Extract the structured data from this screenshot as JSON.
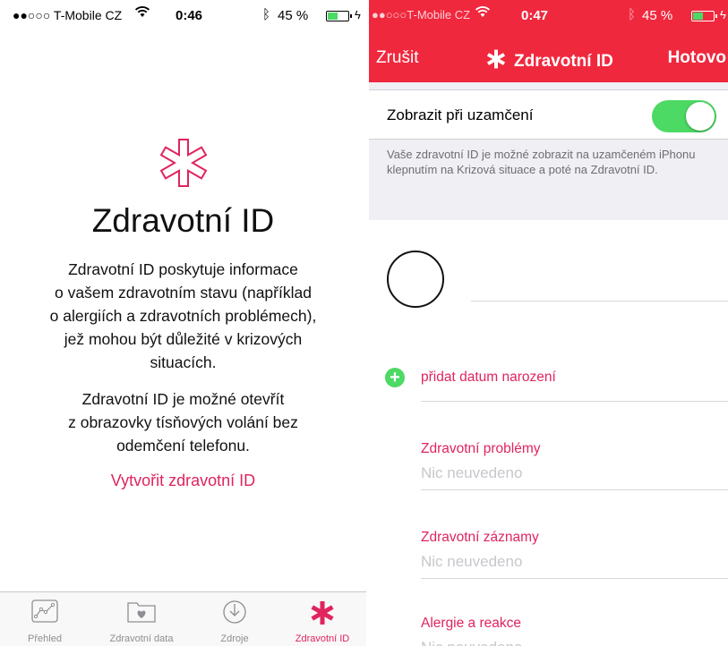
{
  "left": {
    "status_bar": {
      "carrier": "●●○○○ T-Mobile CZ",
      "time": "0:46",
      "battery_percent": "45 %"
    },
    "title": "Zdravotní ID",
    "paragraph1": [
      "Zdravotní ID poskytuje informace",
      "o vašem zdravotním stavu (například",
      "o alergiích a zdravotních problémech),",
      "jež mohou být důležité v krizových",
      "situacích."
    ],
    "paragraph2": [
      "Zdravotní ID je možné otevřít",
      "z obrazovky tísňových volání bez",
      "odemčení telefonu."
    ],
    "create_link": "Vytvořit zdravotní ID",
    "tabs": [
      {
        "label": "Přehled",
        "icon": "dashboard-chart-icon"
      },
      {
        "label": "Zdravotní data",
        "icon": "health-data-folder-icon"
      },
      {
        "label": "Zdroje",
        "icon": "sources-download-icon"
      },
      {
        "label": "Zdravotní ID",
        "icon": "medical-asterisk-icon"
      }
    ],
    "active_tab": "Zdravotní ID"
  },
  "right": {
    "status_bar": {
      "carrier": "●●○○○T-Mobile CZ",
      "time": "0:47",
      "battery_percent": "45 %"
    },
    "nav": {
      "cancel": "Zrušit",
      "title": "Zdravotní ID",
      "done": "Hotovo"
    },
    "lock_screen": {
      "label": "Zobrazit při uzamčení",
      "enabled": true,
      "note": "Vaše zdravotní ID je možné zobrazit na uzamčeném iPhonu klepnutím na Krizová situace a poté na Zdravotní ID."
    },
    "add_birthdate": "přidat datum narození",
    "fields": [
      {
        "label": "Zdravotní problémy",
        "value": "Nic neuvedeno"
      },
      {
        "label": "Zdravotní záznamy",
        "value": "Nic neuvedeno"
      },
      {
        "label": "Alergie a reakce",
        "value": "Nic neuvedeno"
      }
    ]
  },
  "colors": {
    "accent_pink": "#e0245e",
    "nav_red": "#f0283e",
    "toggle_green": "#4cd964",
    "placeholder_gray": "#c7c7cc"
  }
}
